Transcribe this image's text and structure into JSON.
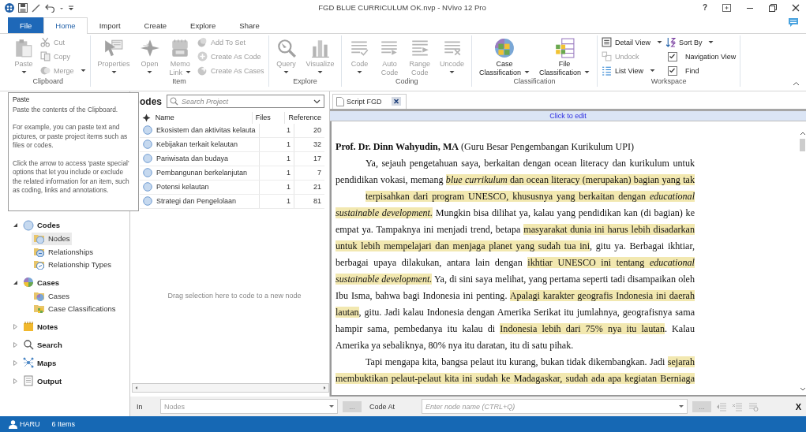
{
  "window": {
    "title": "FGD BLUE CURRICULUM OK.nvp - NVivo 12 Pro",
    "help": "?"
  },
  "tabs": [
    {
      "label": "File",
      "kind": "file",
      "selected": false
    },
    {
      "label": "Home",
      "kind": "tab",
      "selected": true
    },
    {
      "label": "Import",
      "kind": "tab",
      "selected": false
    },
    {
      "label": "Create",
      "kind": "tab",
      "selected": false
    },
    {
      "label": "Explore",
      "kind": "tab",
      "selected": false
    },
    {
      "label": "Share",
      "kind": "tab",
      "selected": false
    }
  ],
  "ribbon": {
    "groups": [
      {
        "label": "Clipboard",
        "items": [
          {
            "kind": "large",
            "lines": [
              "Paste"
            ],
            "dropdown": true,
            "disabled": true
          },
          {
            "kind": "small",
            "label": "Cut",
            "dropdown": false,
            "disabled": true
          },
          {
            "kind": "small",
            "label": "Copy",
            "dropdown": false,
            "disabled": true
          },
          {
            "kind": "small",
            "label": "Merge",
            "dropdown": true,
            "disabled": true
          }
        ]
      },
      {
        "label": "Item",
        "items": [
          {
            "kind": "large",
            "lines": [
              "Properties"
            ],
            "dropdown": true,
            "disabled": true
          },
          {
            "kind": "large",
            "lines": [
              "Open"
            ],
            "dropdown": true,
            "disabled": true
          },
          {
            "kind": "large",
            "lines": [
              "Memo",
              "Link"
            ],
            "dropdown": true,
            "disabled": true
          },
          {
            "kind": "small",
            "label": "Add To Set",
            "dropdown": false,
            "disabled": true
          },
          {
            "kind": "small",
            "label": "Create As Code",
            "dropdown": false,
            "disabled": true
          },
          {
            "kind": "small",
            "label": "Create As Cases",
            "dropdown": false,
            "disabled": true
          }
        ]
      },
      {
        "label": "Explore",
        "items": [
          {
            "kind": "large",
            "lines": [
              "Query"
            ],
            "dropdown": true,
            "disabled": true
          },
          {
            "kind": "large",
            "lines": [
              "Visualize"
            ],
            "dropdown": true,
            "disabled": true
          }
        ]
      },
      {
        "label": "Coding",
        "items": [
          {
            "kind": "large",
            "lines": [
              "Code"
            ],
            "dropdown": true,
            "disabled": true
          },
          {
            "kind": "large",
            "lines": [
              "Auto",
              "Code"
            ],
            "dropdown": false,
            "disabled": true
          },
          {
            "kind": "large",
            "lines": [
              "Range",
              "Code"
            ],
            "dropdown": false,
            "disabled": true
          },
          {
            "kind": "large",
            "lines": [
              "Uncode"
            ],
            "dropdown": true,
            "disabled": true
          }
        ]
      },
      {
        "label": "Classification",
        "items": [
          {
            "kind": "large",
            "lines": [
              "Case",
              "Classification"
            ],
            "dropdown": true,
            "disabled": false
          },
          {
            "kind": "large",
            "lines": [
              "File",
              "Classification"
            ],
            "dropdown": true,
            "disabled": false
          }
        ]
      },
      {
        "label": "Workspace",
        "items": [
          {
            "kind": "small",
            "label": "Detail View",
            "dropdown": true,
            "disabled": false
          },
          {
            "kind": "small",
            "label": "Undock",
            "dropdown": false,
            "disabled": true
          },
          {
            "kind": "small",
            "label": "List View",
            "dropdown": true,
            "disabled": false
          },
          {
            "kind": "small",
            "label": "Sort By",
            "dropdown": true,
            "disabled": false
          },
          {
            "kind": "check",
            "label": "Navigation View",
            "checked": true,
            "disabled": false
          },
          {
            "kind": "check",
            "label": "Find",
            "checked": true,
            "disabled": false
          }
        ]
      }
    ]
  },
  "tooltip": {
    "title": "Paste",
    "paragraphs": [
      "Paste the contents of the Clipboard.",
      "For example, you can paste text and pictures, or paste project items such as files or codes.",
      "Click the arrow to access 'paste special' options that let you include or exclude the related information for an item, such as coding, links and annotations."
    ]
  },
  "nav": {
    "items": [
      {
        "label": "Codes",
        "expanded": true,
        "selected": false,
        "children": [
          {
            "label": "Nodes",
            "selected": true
          },
          {
            "label": "Relationships",
            "selected": false
          },
          {
            "label": "Relationship Types",
            "selected": false
          }
        ]
      },
      {
        "label": "Cases",
        "expanded": true,
        "selected": false,
        "children": [
          {
            "label": "Cases",
            "selected": false
          },
          {
            "label": "Case Classifications",
            "selected": false
          }
        ]
      },
      {
        "label": "Notes",
        "expanded": false,
        "selected": false
      },
      {
        "label": "Search",
        "expanded": false,
        "selected": false
      },
      {
        "label": "Maps",
        "expanded": false,
        "selected": false
      },
      {
        "label": "Output",
        "expanded": false,
        "selected": false
      }
    ]
  },
  "list_pane": {
    "title": "odes",
    "search": {
      "placeholder": "Search Project"
    },
    "columns": [
      "Name",
      "Files",
      "Reference"
    ],
    "rows": [
      {
        "name": "Ekosistem dan aktivitas kelauta",
        "files": "1",
        "references": "20",
        "selected": false
      },
      {
        "name": "Kebijakan terkait kelautan",
        "files": "1",
        "references": "32",
        "selected": false
      },
      {
        "name": "Pariwisata dan budaya",
        "files": "1",
        "references": "17",
        "selected": false
      },
      {
        "name": "Pembangunan berkelanjutan",
        "files": "1",
        "references": "7",
        "selected": false
      },
      {
        "name": "Potensi kelautan",
        "files": "1",
        "references": "21",
        "selected": false
      },
      {
        "name": "Strategi dan Pengelolaan",
        "files": "1",
        "references": "81",
        "selected": false
      }
    ],
    "empty_hint": "Drag selection here to code to a new node"
  },
  "document": {
    "tab": {
      "label": "Script FGD",
      "selected": true
    },
    "edit_bar": "Click to edit",
    "lines": [
      {
        "indent": false,
        "justify": false,
        "segments": [
          {
            "text": "**Prof. Dr. Dinn Wahyudin, MA** (Guru Besar Pengembangan Kurikulum UPI)",
            "highlighted": false
          }
        ]
      },
      {
        "indent": true,
        "justify": true,
        "segments": [
          {
            "text": "Ya, sejauh pengetahuan saya, berkaitan dengan ocean literacy dan kurikulum untuk",
            "highlighted": false
          }
        ]
      },
      {
        "indent": false,
        "justify": true,
        "segments": [
          {
            "text": "pendidikan vokasi, memang ",
            "highlighted": false
          },
          {
            "text": "*blue currikulum* dan ocean literacy (merupakan) bagian yang tak",
            "highlighted": true
          }
        ]
      },
      {
        "indent": true,
        "justify": true,
        "segments": [
          {
            "text": "terpisahkan dari program UNESCO, khususnya yang berkaitan dengan *educational*",
            "highlighted": true
          }
        ]
      },
      {
        "indent": false,
        "justify": true,
        "segments": [
          {
            "text": "*sustainable development.*",
            "highlighted": true
          },
          {
            "text": " Mungkin bisa dilihat ya, kalau yang pendidikan kan (di bagian) ke",
            "highlighted": false
          }
        ]
      },
      {
        "indent": false,
        "justify": true,
        "segments": [
          {
            "text": "empat ya. Tampaknya ini menjadi trend, betapa ",
            "highlighted": false
          },
          {
            "text": "masyarakat dunia ini harus lebih disadarkan",
            "highlighted": true
          }
        ]
      },
      {
        "indent": false,
        "justify": true,
        "segments": [
          {
            "text": "untuk lebih mempelajari dan menjaga planet yang sudah tua ini",
            "highlighted": true
          },
          {
            "text": ", gitu ya. Berbagai ikhtiar,",
            "highlighted": false
          }
        ]
      },
      {
        "indent": false,
        "justify": true,
        "segments": [
          {
            "text": "berbagai upaya dilakukan, antara lain dengan ",
            "highlighted": false
          },
          {
            "text": "ikhtiar UNESCO ini tentang *educational*",
            "highlighted": true
          }
        ]
      },
      {
        "indent": false,
        "justify": true,
        "segments": [
          {
            "text": "*sustainable development.*",
            "highlighted": true
          },
          {
            "text": " Ya, di sini saya melihat, yang pertama seperti tadi disampaikan oleh",
            "highlighted": false
          }
        ]
      },
      {
        "indent": false,
        "justify": true,
        "segments": [
          {
            "text": "Ibu Isma, bahwa bagi Indonesia ini penting. ",
            "highlighted": false
          },
          {
            "text": "Apalagi karakter geografis Indonesia ini daerah",
            "highlighted": true
          }
        ]
      },
      {
        "indent": false,
        "justify": true,
        "segments": [
          {
            "text": "lautan",
            "highlighted": true
          },
          {
            "text": ", gitu. Jadi kalau Indonesia dengan Amerika Serikat itu jumlahnya, geografisnya sama",
            "highlighted": false
          }
        ]
      },
      {
        "indent": false,
        "justify": true,
        "segments": [
          {
            "text": "hampir sama, pembedanya itu kalau di ",
            "highlighted": false
          },
          {
            "text": "Indonesia lebih dari 75% nya itu lautan",
            "highlighted": true
          },
          {
            "text": ". Kalau",
            "highlighted": false
          }
        ]
      },
      {
        "indent": false,
        "justify": false,
        "segments": [
          {
            "text": "Amerika ya sebaliknya, 80% nya itu daratan, itu di satu pihak.",
            "highlighted": false
          }
        ]
      },
      {
        "indent": true,
        "justify": true,
        "segments": [
          {
            "text": "Tapi mengapa kita, bangsa pelaut itu kurang, bukan tidak dikembangkan. Jadi ",
            "highlighted": false
          },
          {
            "text": "sejarah",
            "highlighted": true
          }
        ]
      },
      {
        "indent": false,
        "justify": true,
        "segments": [
          {
            "text": "membuktikan pelaut-pelaut kita ini sudah ke Madagaskar, sudah ada apa kegiatan Berniaga",
            "highlighted": true
          }
        ]
      }
    ]
  },
  "code_bar": {
    "in_label": "In",
    "in_field": {
      "value": "Nodes",
      "disabled": true
    },
    "in_browse": "...",
    "code_at_label": "Code At",
    "node_field": {
      "placeholder": "Enter node name (CTRL+Q)"
    },
    "node_browse": "...",
    "close": "X"
  },
  "status_bar": {
    "user": "HARU",
    "items": "6 Items"
  }
}
